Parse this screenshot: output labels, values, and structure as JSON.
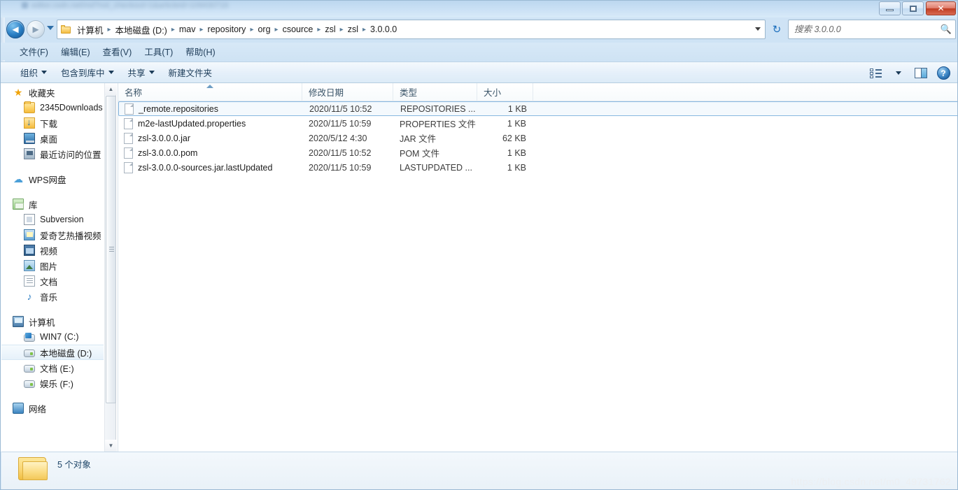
{
  "window": {
    "title_blurred": "editor.csdn.net/md?not_checkout=1&articleId=109430716",
    "controls": {
      "minimize": "minimize-button",
      "maximize": "maximize-button",
      "close": "close-button"
    }
  },
  "address": {
    "back_label": "◄",
    "forward_label": "►",
    "crumbs": [
      "计算机",
      "本地磁盘 (D:)",
      "mav",
      "repository",
      "org",
      "csource",
      "zsl",
      "zsl",
      "3.0.0.0"
    ],
    "separator": "▸",
    "refresh_label": "↻"
  },
  "search": {
    "placeholder": "搜索 3.0.0.0",
    "value": "",
    "icon": "search-icon"
  },
  "menu": {
    "items": [
      "文件(F)",
      "编辑(E)",
      "查看(V)",
      "工具(T)",
      "帮助(H)"
    ]
  },
  "toolbar": {
    "items": [
      {
        "label": "组织",
        "has_caret": true
      },
      {
        "label": "包含到库中",
        "has_caret": true
      },
      {
        "label": "共享",
        "has_caret": true
      },
      {
        "label": "新建文件夹",
        "has_caret": false
      }
    ],
    "right_icons": [
      "view-list-icon",
      "view-dropdown-caret",
      "preview-pane-icon",
      "help-icon"
    ],
    "help_glyph": "?"
  },
  "sidebar": {
    "groups": [
      {
        "head": {
          "label": "收藏夹",
          "icon": "star-icon"
        },
        "children": [
          {
            "label": "2345Downloads",
            "icon": "folder-icon"
          },
          {
            "label": "下载",
            "icon": "download-folder-icon"
          },
          {
            "label": "桌面",
            "icon": "desktop-icon"
          },
          {
            "label": "最近访问的位置",
            "icon": "recent-places-icon"
          }
        ]
      },
      {
        "head": {
          "label": "WPS网盘",
          "icon": "cloud-icon"
        },
        "children": []
      },
      {
        "head": {
          "label": "库",
          "icon": "library-icon"
        },
        "children": [
          {
            "label": "Subversion",
            "icon": "subversion-icon"
          },
          {
            "label": "爱奇艺热播视频",
            "icon": "iqiyi-icon"
          },
          {
            "label": "视频",
            "icon": "video-icon"
          },
          {
            "label": "图片",
            "icon": "picture-icon"
          },
          {
            "label": "文档",
            "icon": "document-icon"
          },
          {
            "label": "音乐",
            "icon": "music-icon"
          }
        ]
      },
      {
        "head": {
          "label": "计算机",
          "icon": "computer-icon"
        },
        "children": [
          {
            "label": "WIN7 (C:)",
            "icon": "windows-drive-icon",
            "selected": false
          },
          {
            "label": "本地磁盘 (D:)",
            "icon": "drive-icon",
            "selected": true
          },
          {
            "label": "文档 (E:)",
            "icon": "drive-icon",
            "selected": false
          },
          {
            "label": "娱乐 (F:)",
            "icon": "drive-icon",
            "selected": false
          }
        ]
      },
      {
        "head": {
          "label": "网络",
          "icon": "network-icon"
        },
        "children": []
      }
    ],
    "scrollbar": {
      "up": "▲",
      "down": "▼"
    }
  },
  "filelist": {
    "columns": [
      {
        "key": "name",
        "label": "名称",
        "sorted": true
      },
      {
        "key": "date",
        "label": "修改日期",
        "sorted": false
      },
      {
        "key": "type",
        "label": "类型",
        "sorted": false
      },
      {
        "key": "size",
        "label": "大小",
        "sorted": false
      }
    ],
    "rows": [
      {
        "name": "_remote.repositories",
        "date": "2020/11/5 10:52",
        "type": "REPOSITORIES ...",
        "size": "1 KB",
        "selected": true
      },
      {
        "name": "m2e-lastUpdated.properties",
        "date": "2020/11/5 10:59",
        "type": "PROPERTIES 文件",
        "size": "1 KB",
        "selected": false
      },
      {
        "name": "zsl-3.0.0.0.jar",
        "date": "2020/5/12 4:30",
        "type": "JAR 文件",
        "size": "62 KB",
        "selected": false
      },
      {
        "name": "zsl-3.0.0.0.pom",
        "date": "2020/11/5 10:52",
        "type": "POM 文件",
        "size": "1 KB",
        "selected": false
      },
      {
        "name": "zsl-3.0.0.0-sources.jar.lastUpdated",
        "date": "2020/11/5 10:59",
        "type": "LASTUPDATED ...",
        "size": "1 KB",
        "selected": false
      }
    ]
  },
  "status": {
    "text": "5 个对象",
    "icon": "folder-icon"
  },
  "watermark": {
    "text": "https://blog.csdn.net/m0_49731762"
  },
  "colors": {
    "chrome": "#cfe3f5",
    "accent": "#1c6fb8",
    "selection": "#88b8e0",
    "close_red": "#bf3c22"
  }
}
